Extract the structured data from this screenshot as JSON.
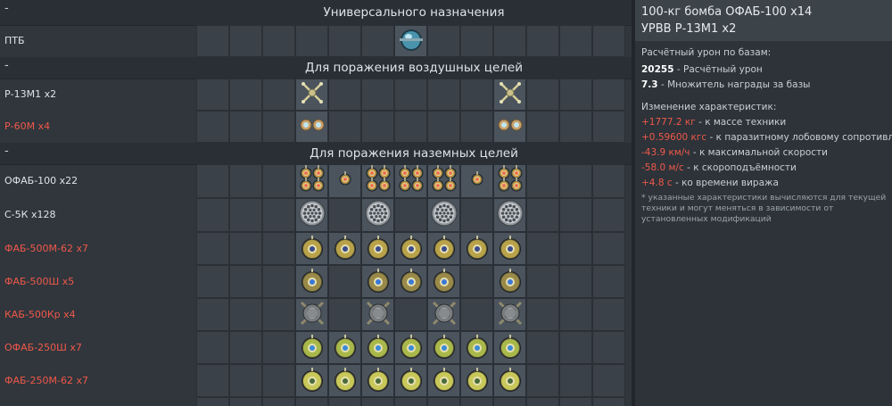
{
  "sections": [
    {
      "dash": "-",
      "title": "Универсального назначения"
    },
    {
      "dash": "-",
      "title": "Для поражения воздушных целей"
    },
    {
      "dash": "-",
      "title": "Для поражения наземных целей"
    }
  ],
  "weapons": [
    {
      "label": "ПТБ",
      "color": "white",
      "icon": "drop-tank-icon"
    },
    {
      "label": "Р-13М1 x2",
      "color": "white",
      "icon": "missile-crossed-icon"
    },
    {
      "label": "Р-60М x4",
      "color": "red",
      "icon": "missile-pair-icon"
    },
    {
      "label": "ОФАБ-100 x22",
      "color": "white",
      "icon": "small-bomb-cluster-icon"
    },
    {
      "label": "С-5К x128",
      "color": "white",
      "icon": "rocket-pod-icon"
    },
    {
      "label": "ФАБ-500М-62 x7",
      "color": "red",
      "icon": "bomb-yellow-icon"
    },
    {
      "label": "ФАБ-500Ш x5",
      "color": "red",
      "icon": "bomb-blue-icon"
    },
    {
      "label": "КАБ-500Кр x4",
      "color": "red",
      "icon": "guided-bomb-icon"
    },
    {
      "label": "ОФАБ-250Ш x7",
      "color": "red",
      "icon": "bomb-green-icon"
    },
    {
      "label": "ФАБ-250М-62 x7",
      "color": "red",
      "icon": "bomb-lime-icon"
    }
  ],
  "colors": {
    "accent_red": "#f0584a",
    "panel": "#2d3339",
    "header": "#3c4349"
  },
  "info": {
    "title_line1": "100-кг бомба ОФАБ-100 x14",
    "title_line2": "УРВВ Р-13М1 x2",
    "damage_heading": "Расчётный урон по базам:",
    "damage_value": "20255",
    "damage_label": " - Расчётный урон",
    "mult_value": "7.3",
    "mult_label": " - Множитель награды за базы",
    "changes_heading": "Изменение характеристик:",
    "changes": [
      {
        "value": "+1777.2 кг",
        "label": " - к массе техники"
      },
      {
        "value": "+0.59600 кгс",
        "label": " - к паразитному лобовому сопротивлению"
      },
      {
        "value": "-43.9 км/ч",
        "label": " - к максимальной скорости"
      },
      {
        "value": "-58.0 м/с",
        "label": " - к скороподъёмности"
      },
      {
        "value": "+4.8 с",
        "label": " - ко времени виража"
      }
    ],
    "note": "* указанные характеристики вычисляются для текущей техники и могут меняться в зависимости от установленных модификаций"
  }
}
